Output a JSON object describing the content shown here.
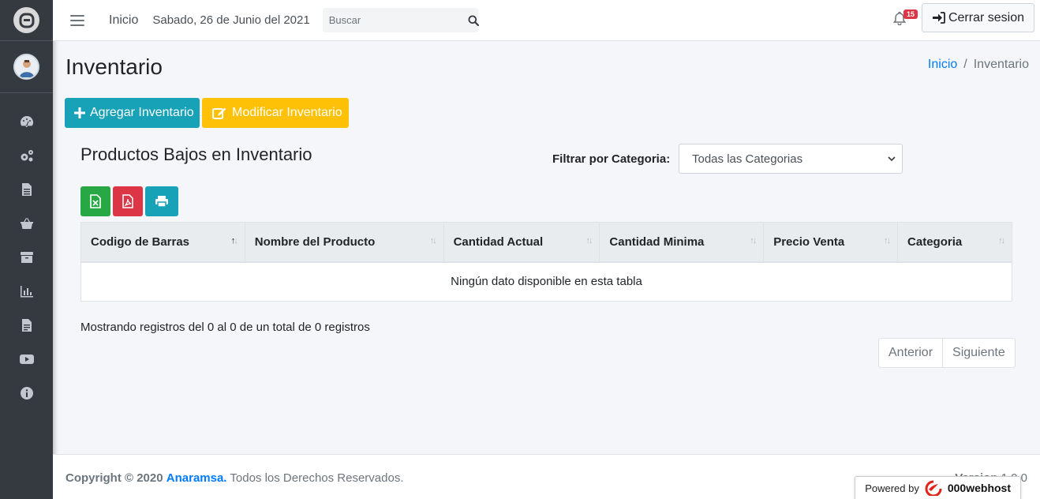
{
  "topbar": {
    "home_label": "Inicio",
    "date": "Sabado, 26 de Junio del 2021",
    "search_placeholder": "Buscar",
    "notification_count": "15",
    "logout_label": "Cerrar sesion"
  },
  "sidebar": {
    "items": [
      {
        "icon": "dashboard-icon"
      },
      {
        "icon": "settings-icon"
      },
      {
        "icon": "file-icon"
      },
      {
        "icon": "basket-icon"
      },
      {
        "icon": "archive-icon"
      },
      {
        "icon": "chart-icon"
      },
      {
        "icon": "report-icon"
      },
      {
        "icon": "video-icon"
      },
      {
        "icon": "info-icon"
      }
    ]
  },
  "page": {
    "title": "Inventario",
    "breadcrumb": {
      "home": "Inicio",
      "separator": "/",
      "current": "Inventario"
    },
    "buttons": {
      "add": "Agregar Inventario",
      "modify": "Modificar Inventario"
    },
    "card_title": "Productos Bajos en Inventario",
    "filter_label": "Filtrar por Categoria:",
    "filter_value": "Todas las Categorias"
  },
  "table": {
    "columns": [
      "Codigo de Barras",
      "Nombre del Producto",
      "Cantidad Actual",
      "Cantidad Minima",
      "Precio Venta",
      "Categoria"
    ],
    "empty_message": "Ningún dato disponible en esta tabla",
    "info": "Mostrando registros del 0 al 0 de un total de 0 registros",
    "prev_label": "Anterior",
    "next_label": "Siguiente"
  },
  "footer": {
    "copyright": "Copyright © 2020",
    "company": "Anaramsa.",
    "rights": "Todos los Derechos Reservados.",
    "version_label": "Version",
    "version": "1.0.0",
    "powered_by": "Powered by",
    "host": "000webhost"
  },
  "colors": {
    "sidebar": "#343a40",
    "info": "#17a2b8",
    "warning": "#ffc107",
    "success": "#28a745",
    "danger": "#dc3545",
    "link": "#007bff"
  }
}
